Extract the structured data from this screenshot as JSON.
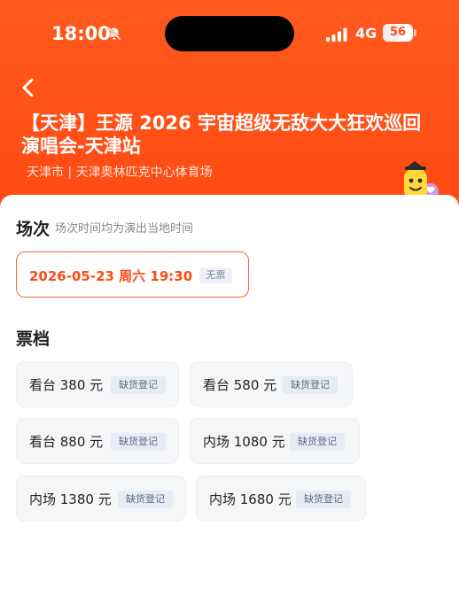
{
  "status_bar": {
    "time": "18:00",
    "network": "4G",
    "battery": "56",
    "battery_level": 0.56,
    "icons": [
      "bell-off-icon",
      "signal-icon",
      "battery-icon"
    ]
  },
  "header": {
    "back_icon": "chevron-left-icon",
    "title": "【天津】王源 2026 宇宙超级无敌大大狂欢巡回演唱会-天津站",
    "venue": "天津市 | 天津奥林匹克中心体育场",
    "background_color": "#ff4a12"
  },
  "session": {
    "section_title": "场次",
    "section_hint": "场次时间均为演出当地时间",
    "items": [
      {
        "datetime": "2026-05-23 周六 19:30",
        "badge": "无票"
      }
    ]
  },
  "tickets": {
    "section_title": "票档",
    "items": [
      {
        "label": "看台 380 元",
        "badge": "缺货登记"
      },
      {
        "label": "看台 580 元",
        "badge": "缺货登记"
      },
      {
        "label": "看台 880 元",
        "badge": "缺货登记"
      },
      {
        "label": "内场 1080 元",
        "badge": "缺货登记"
      },
      {
        "label": "内场 1380 元",
        "badge": "缺货登记"
      },
      {
        "label": "内场 1680 元",
        "badge": "缺货登记"
      }
    ]
  },
  "colors": {
    "accent": "#ff4a12",
    "selected_border": "#f26a3a"
  }
}
